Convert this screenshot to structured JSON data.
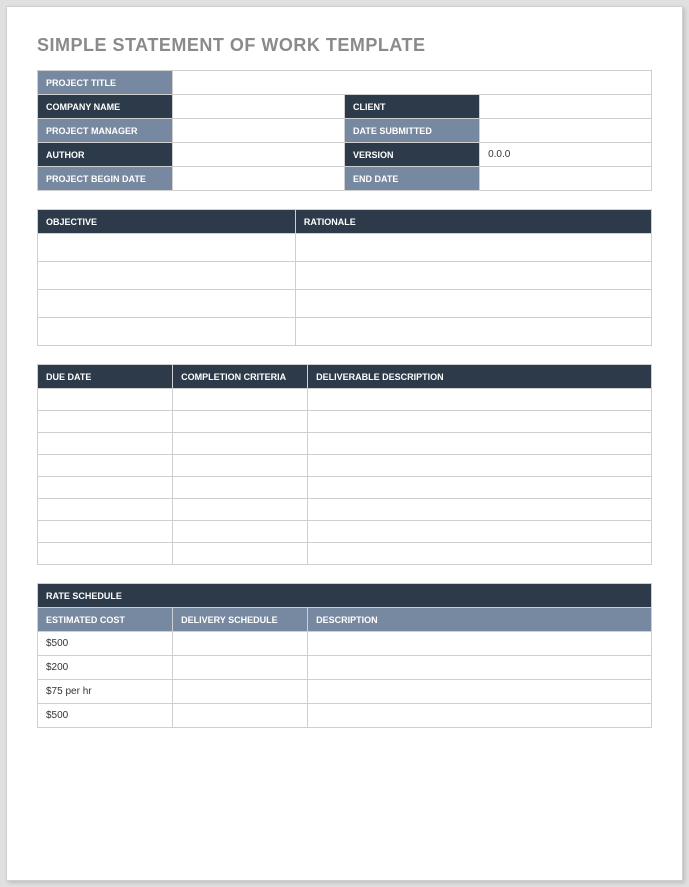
{
  "title": "SIMPLE STATEMENT OF WORK TEMPLATE",
  "meta": {
    "project_title_label": "PROJECT TITLE",
    "project_title_value": "",
    "company_name_label": "COMPANY NAME",
    "company_name_value": "",
    "client_label": "CLIENT",
    "client_value": "",
    "project_manager_label": "PROJECT MANAGER",
    "project_manager_value": "",
    "date_submitted_label": "DATE SUBMITTED",
    "date_submitted_value": "",
    "author_label": "AUTHOR",
    "author_value": "",
    "version_label": "VERSION",
    "version_value": "0.0.0",
    "begin_date_label": "PROJECT BEGIN DATE",
    "begin_date_value": "",
    "end_date_label": "END DATE",
    "end_date_value": ""
  },
  "objectives": {
    "objective_label": "OBJECTIVE",
    "rationale_label": "RATIONALE",
    "rows": [
      {
        "objective": "",
        "rationale": ""
      },
      {
        "objective": "",
        "rationale": ""
      },
      {
        "objective": "",
        "rationale": ""
      },
      {
        "objective": "",
        "rationale": ""
      }
    ]
  },
  "deliverables": {
    "due_date_label": "DUE DATE",
    "criteria_label": "COMPLETION CRITERIA",
    "description_label": "DELIVERABLE DESCRIPTION",
    "rows": [
      {
        "due": "",
        "criteria": "",
        "desc": ""
      },
      {
        "due": "",
        "criteria": "",
        "desc": ""
      },
      {
        "due": "",
        "criteria": "",
        "desc": ""
      },
      {
        "due": "",
        "criteria": "",
        "desc": ""
      },
      {
        "due": "",
        "criteria": "",
        "desc": ""
      },
      {
        "due": "",
        "criteria": "",
        "desc": ""
      },
      {
        "due": "",
        "criteria": "",
        "desc": ""
      },
      {
        "due": "",
        "criteria": "",
        "desc": ""
      }
    ]
  },
  "rates": {
    "schedule_label": "RATE SCHEDULE",
    "cost_label": "ESTIMATED COST",
    "delivery_label": "DELIVERY SCHEDULE",
    "description_label": "DESCRIPTION",
    "rows": [
      {
        "cost": "$500",
        "delivery": "",
        "desc": ""
      },
      {
        "cost": "$200",
        "delivery": "",
        "desc": ""
      },
      {
        "cost": "$75 per hr",
        "delivery": "",
        "desc": ""
      },
      {
        "cost": "$500",
        "delivery": "",
        "desc": ""
      }
    ]
  }
}
